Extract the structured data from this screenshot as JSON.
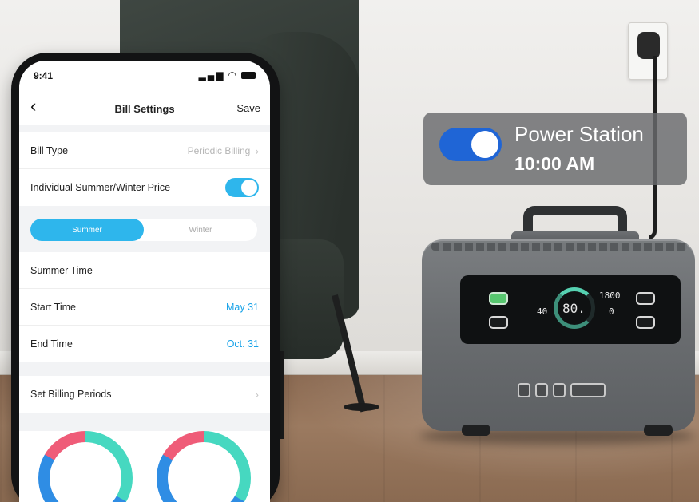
{
  "phone": {
    "status": {
      "time": "9:41"
    },
    "nav": {
      "back_icon": "chevron-left-icon",
      "title": "Bill Settings",
      "save_label": "Save"
    },
    "bill_type": {
      "label": "Bill Type",
      "value": "Periodic Billing"
    },
    "summer_winter": {
      "label": "Individual Summer/Winter Price",
      "enabled": true
    },
    "season_tabs": [
      {
        "label": "Summer",
        "active": true
      },
      {
        "label": "Winter",
        "active": false
      }
    ],
    "summer_time": {
      "header": "Summer Time",
      "start": {
        "label": "Start Time",
        "value": "May 31"
      },
      "end": {
        "label": "End Time",
        "value": "Oct. 31"
      }
    },
    "billing_periods": {
      "label": "Set Billing Periods"
    }
  },
  "overlay": {
    "title": "Power Station",
    "time": "10:00 AM",
    "toggle_on": true
  },
  "device_display": {
    "percent": "80.",
    "left_reading": "40",
    "right_reading": "1800",
    "right_small": "0"
  },
  "colors": {
    "accent": "#2eb6ec",
    "link_blue": "#1aa3e8",
    "overlay_toggle": "#1f65d6",
    "dial_teal": "#46d8c0",
    "dial_blue": "#2f8de4",
    "dial_pink": "#ef5c78"
  }
}
